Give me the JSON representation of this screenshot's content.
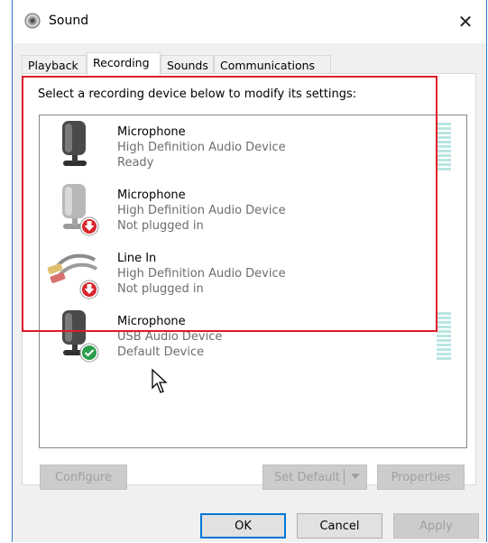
{
  "window": {
    "title": "Sound",
    "close_glyph": "✕",
    "icon": "speaker-icon"
  },
  "tabs": [
    {
      "label": "Playback",
      "active": false
    },
    {
      "label": "Recording",
      "active": true
    },
    {
      "label": "Sounds",
      "active": false
    },
    {
      "label": "Communications",
      "active": false
    }
  ],
  "instruction": "Select a recording device below to modify its settings:",
  "devices": [
    {
      "name": "Microphone",
      "driver": "High Definition Audio Device",
      "status": "Ready",
      "icon": "microphone-icon",
      "badge": "none",
      "level_meter": true
    },
    {
      "name": "Microphone",
      "driver": "High Definition Audio Device",
      "status": "Not plugged in",
      "icon": "microphone-icon",
      "badge": "unplugged-down-arrow-icon",
      "level_meter": false
    },
    {
      "name": "Line In",
      "driver": "High Definition Audio Device",
      "status": "Not plugged in",
      "icon": "rca-cable-icon",
      "badge": "unplugged-down-arrow-icon",
      "level_meter": false
    },
    {
      "name": "Microphone",
      "driver": "USB Audio Device",
      "status": "Default Device",
      "icon": "microphone-icon",
      "badge": "default-check-icon",
      "level_meter": true
    }
  ],
  "buttons": {
    "configure": "Configure",
    "set_default": "Set Default",
    "properties": "Properties",
    "ok": "OK",
    "cancel": "Cancel",
    "apply": "Apply"
  },
  "colors": {
    "highlight": "#e01a27",
    "badge_red": "#d9242b",
    "badge_green": "#2a9d4a",
    "level_bar": "#b9e6e1"
  }
}
